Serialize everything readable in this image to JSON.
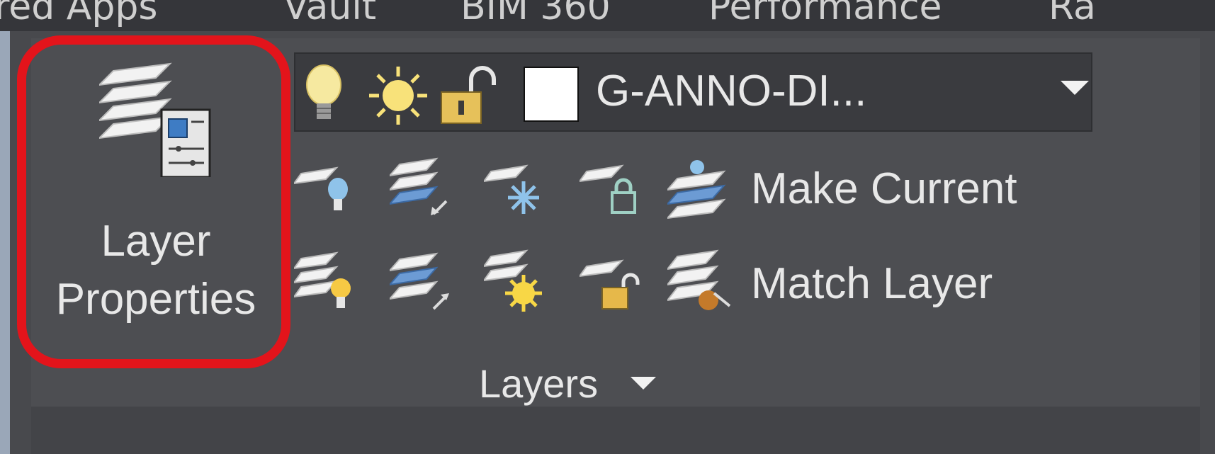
{
  "ribbon_tabs": [
    "red Apps",
    "Vault",
    "BIM 360",
    "Performance",
    "Ra"
  ],
  "layer_properties": {
    "label_line1": "Layer",
    "label_line2": "Properties",
    "icon": "layer-stack-properties-icon"
  },
  "layer_combo": {
    "current_layer": "G-ANNO-DI...",
    "state_icons": [
      "lightbulb-on-icon",
      "sun-thawed-icon",
      "lock-open-icon"
    ],
    "swatch_color": "#ffffff"
  },
  "tools_row1": {
    "icons": [
      "layer-off-icon",
      "layer-isolate-icon",
      "layer-freeze-icon",
      "layer-lock-icon",
      "make-current-icon"
    ],
    "label": "Make Current"
  },
  "tools_row2": {
    "icons": [
      "layer-on-icon",
      "layer-unisolate-icon",
      "layer-thaw-icon",
      "layer-unlock-icon",
      "match-layer-icon"
    ],
    "label": "Match Layer"
  },
  "panel": {
    "title": "Layers"
  },
  "colors": {
    "highlight": "#e3141b",
    "panel_bg": "#4d4e52",
    "text": "#e8e8e8"
  }
}
